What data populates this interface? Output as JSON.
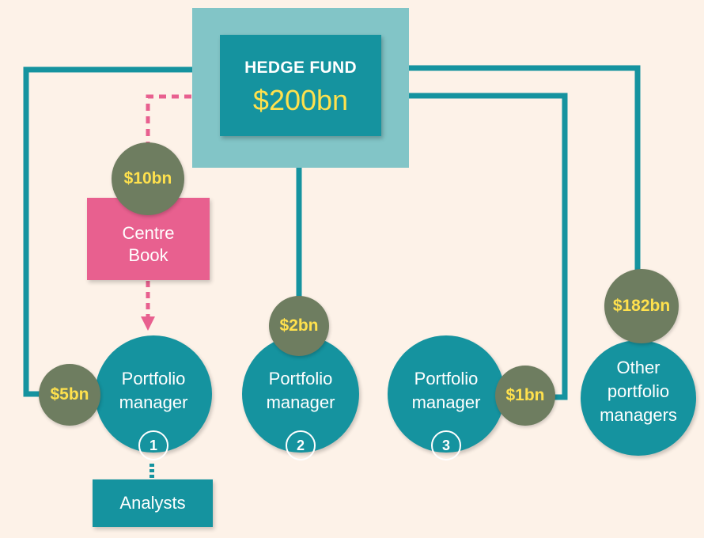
{
  "hedge_fund": {
    "title": "HEDGE FUND",
    "amount": "$200bn"
  },
  "centre_book": {
    "amount": "$10bn",
    "label": "Centre Book"
  },
  "portfolio_managers": [
    {
      "label": "Portfolio manager",
      "number": "1",
      "amount": "$5bn"
    },
    {
      "label": "Portfolio manager",
      "number": "2",
      "amount": "$2bn"
    },
    {
      "label": "Portfolio manager",
      "number": "3",
      "amount": "$1bn"
    }
  ],
  "others": {
    "label": "Other portfolio managers",
    "amount": "$182bn"
  },
  "analysts": {
    "label": "Analysts"
  },
  "colors": {
    "background": "#fdf2e8",
    "teal": "#15939f",
    "light_teal": "#82c5c7",
    "pink": "#e8608f",
    "olive": "#6e7d60",
    "amount_yellow": "#ffe14d"
  }
}
